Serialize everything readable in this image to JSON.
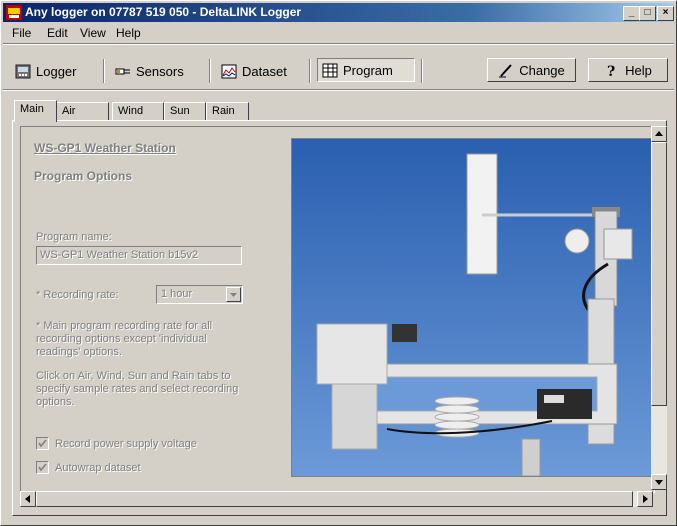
{
  "window": {
    "title": "Any logger on 07787 519 050 - DeltaLINK Logger"
  },
  "menu": [
    "File",
    "Edit",
    "View",
    "Help"
  ],
  "toolbar": {
    "logger": "Logger",
    "sensors": "Sensors",
    "dataset": "Dataset",
    "program": "Program",
    "change": "Change",
    "help": "Help"
  },
  "tabs": [
    "Main",
    "Air",
    "Wind",
    "Sun",
    "Rain"
  ],
  "main": {
    "title": "WS-GP1 Weather Station",
    "subtitle": "Program Options",
    "program_name_label": "Program name:",
    "program_name_value": "WS-GP1 Weather Station b15v2",
    "recording_rate_label": "* Recording rate:",
    "recording_rate_value": "1 hour",
    "note1": "* Main program recording rate for all recording options except 'individual readings' options.",
    "note2": "Click on Air, Wind, Sun and Rain tabs to specify sample rates and select recording options.",
    "record_power_label": "Record power supply voltage",
    "record_power_checked": true,
    "autowrap_label": "Autowrap dataset",
    "autowrap_checked": true
  },
  "colors": {
    "titlebar_start": "#0a246a",
    "titlebar_end": "#a6caf0",
    "face": "#d4d0c8",
    "sky": "#3a6ec0"
  },
  "icons": [
    "logger-icon",
    "sensors-icon",
    "dataset-icon",
    "program-icon",
    "change-pen-icon",
    "help-icon"
  ]
}
